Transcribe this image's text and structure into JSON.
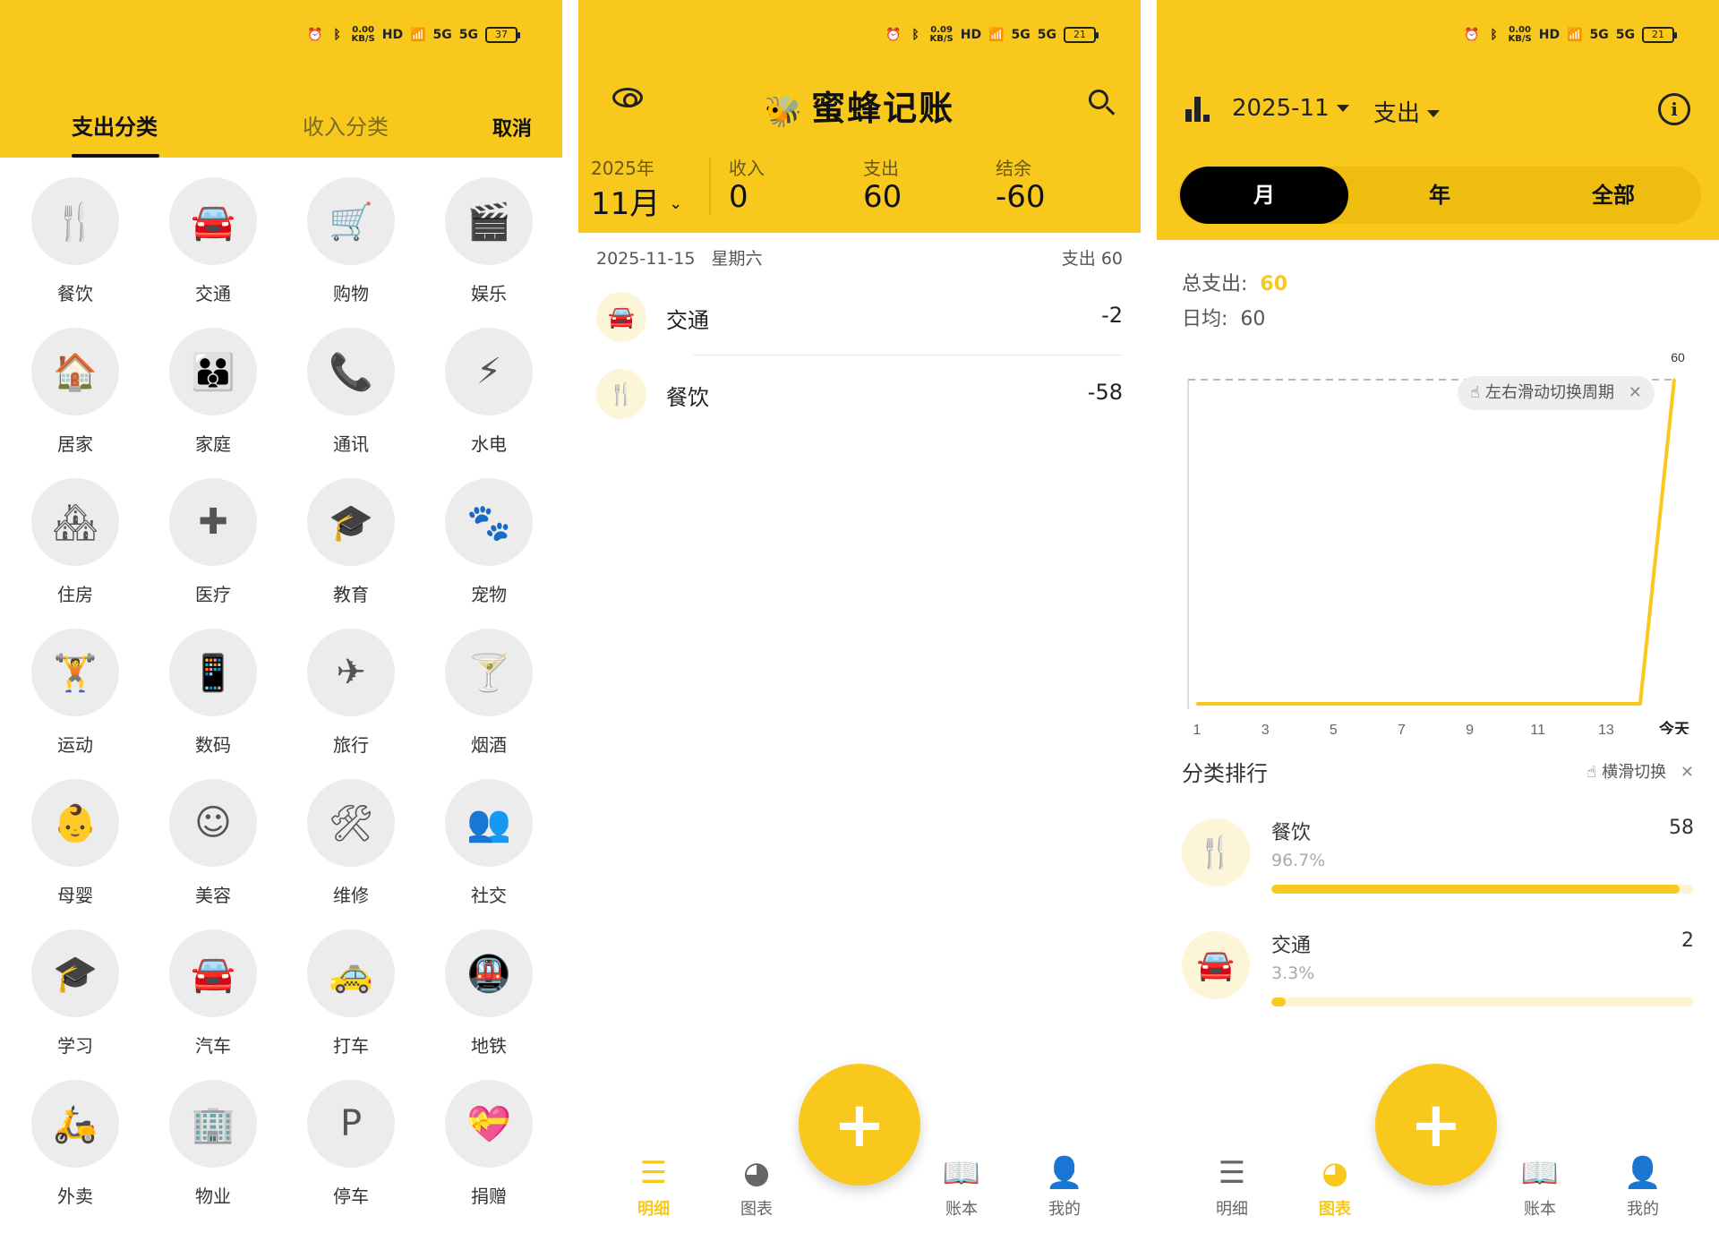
{
  "status_bars": [
    {
      "speed": "0.00",
      "speed_unit": "KB/S",
      "battery": "37"
    },
    {
      "speed": "0.09",
      "speed_unit": "KB/S",
      "battery": "21"
    },
    {
      "speed": "0.00",
      "speed_unit": "KB/S",
      "battery": "21"
    }
  ],
  "status_labels": {
    "hd": "HD",
    "net": "5G"
  },
  "category_screen": {
    "tab_expense": "支出分类",
    "tab_income": "收入分类",
    "cancel": "取消",
    "categories": [
      {
        "label": "餐饮",
        "icon": "cutlery-icon",
        "glyph": "🍴"
      },
      {
        "label": "交通",
        "icon": "car-icon",
        "glyph": "🚘"
      },
      {
        "label": "购物",
        "icon": "cart-icon",
        "glyph": "🛒"
      },
      {
        "label": "娱乐",
        "icon": "clapper-icon",
        "glyph": "🎬"
      },
      {
        "label": "居家",
        "icon": "home-icon",
        "glyph": "🏠"
      },
      {
        "label": "家庭",
        "icon": "family-icon",
        "glyph": "👪"
      },
      {
        "label": "通讯",
        "icon": "phone-icon",
        "glyph": "📞"
      },
      {
        "label": "水电",
        "icon": "bolt-icon",
        "glyph": "⚡"
      },
      {
        "label": "住房",
        "icon": "house-icon",
        "glyph": "🏘"
      },
      {
        "label": "医疗",
        "icon": "medical-icon",
        "glyph": "✚"
      },
      {
        "label": "教育",
        "icon": "school-icon",
        "glyph": "🎓"
      },
      {
        "label": "宠物",
        "icon": "paw-icon",
        "glyph": "🐾"
      },
      {
        "label": "运动",
        "icon": "dumbbell-icon",
        "glyph": "🏋"
      },
      {
        "label": "数码",
        "icon": "smartphone-icon",
        "glyph": "📱"
      },
      {
        "label": "旅行",
        "icon": "airplane-icon",
        "glyph": "✈"
      },
      {
        "label": "烟酒",
        "icon": "cocktail-icon",
        "glyph": "🍸"
      },
      {
        "label": "母婴",
        "icon": "baby-icon",
        "glyph": "👶"
      },
      {
        "label": "美容",
        "icon": "face-icon",
        "glyph": "☺"
      },
      {
        "label": "维修",
        "icon": "tools-icon",
        "glyph": "🛠"
      },
      {
        "label": "社交",
        "icon": "people-icon",
        "glyph": "👥"
      },
      {
        "label": "学习",
        "icon": "graduation-icon",
        "glyph": "🎓"
      },
      {
        "label": "汽车",
        "icon": "car-icon",
        "glyph": "🚘"
      },
      {
        "label": "打车",
        "icon": "taxi-icon",
        "glyph": "🚕"
      },
      {
        "label": "地铁",
        "icon": "subway-icon",
        "glyph": "🚇"
      },
      {
        "label": "外卖",
        "icon": "scooter-icon",
        "glyph": "🛵"
      },
      {
        "label": "物业",
        "icon": "building-icon",
        "glyph": "🏢"
      },
      {
        "label": "停车",
        "icon": "parking-icon",
        "glyph": "P"
      },
      {
        "label": "捐赠",
        "icon": "donate-icon",
        "glyph": "💝"
      }
    ]
  },
  "detail_screen": {
    "app_title": "蜜蜂记账",
    "year": "2025年",
    "month": "11月",
    "income_label": "收入",
    "income_value": "0",
    "expense_label": "支出",
    "expense_value": "60",
    "balance_label": "结余",
    "balance_value": "-60",
    "date": "2025-11-15",
    "weekday": "星期六",
    "day_total": "支出 60",
    "entries": [
      {
        "name": "交通",
        "amount": "-2",
        "icon": "car-icon",
        "glyph": "🚘"
      },
      {
        "name": "餐饮",
        "amount": "-58",
        "icon": "cutlery-icon",
        "glyph": "🍴"
      }
    ]
  },
  "chart_screen": {
    "period": "2025-11",
    "type": "支出",
    "segments": [
      "月",
      "年",
      "全部"
    ],
    "active_segment": "月",
    "total_label": "总支出:",
    "total_value": "60",
    "avg_label": "日均:",
    "avg_value": "60",
    "tooltip": "左右滑动切换周期",
    "rank_title": "分类排行",
    "rank_hint": "横滑切换",
    "ranking": [
      {
        "name": "餐饮",
        "value": "58",
        "percent": "96.7%",
        "fraction": 0.967,
        "icon": "cutlery-icon",
        "glyph": "🍴"
      },
      {
        "name": "交通",
        "value": "2",
        "percent": "3.3%",
        "fraction": 0.033,
        "icon": "car-icon",
        "glyph": "🚘"
      }
    ]
  },
  "nav": [
    {
      "label": "明细",
      "icon": "list-icon",
      "glyph": "☰"
    },
    {
      "label": "图表",
      "icon": "pie-chart-icon",
      "glyph": "◕"
    },
    {
      "label": "账本",
      "icon": "book-icon",
      "glyph": "📖"
    },
    {
      "label": "我的",
      "icon": "user-icon",
      "glyph": "👤"
    }
  ],
  "fab_label": "+",
  "colors": {
    "accent": "#F8C81C",
    "segment_bg": "#EFBD10",
    "text": "#333333"
  },
  "chart_data": {
    "type": "line",
    "x_tick_labels": [
      "1",
      "3",
      "5",
      "7",
      "9",
      "11",
      "13",
      "今天"
    ],
    "x": [
      1,
      2,
      3,
      4,
      5,
      6,
      7,
      8,
      9,
      10,
      11,
      12,
      13,
      14,
      15
    ],
    "values": [
      0,
      0,
      0,
      0,
      0,
      0,
      0,
      0,
      0,
      0,
      0,
      0,
      0,
      0,
      60
    ],
    "max_label": "60",
    "ylim": [
      0,
      60
    ],
    "color": "#F8C81C",
    "grid": false
  }
}
